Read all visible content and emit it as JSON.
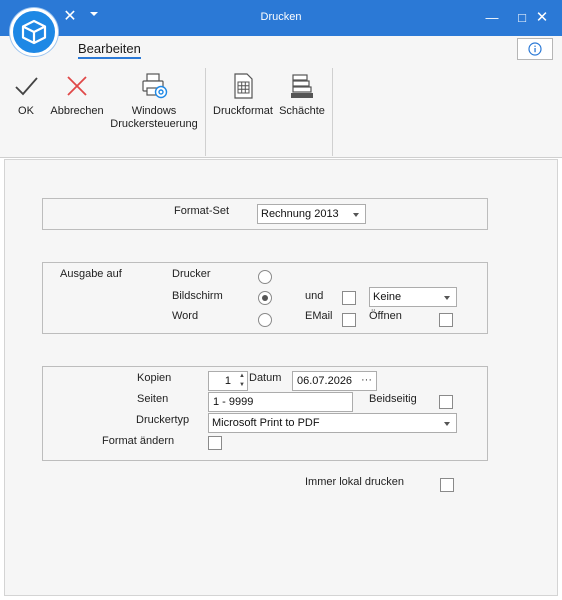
{
  "window": {
    "title": "Drucken",
    "minimize_icon": "minimize-icon",
    "maximize_icon": "maximize-icon",
    "close_icon": "close-icon"
  },
  "ribbon": {
    "tab": "Bearbeiten",
    "buttons": {
      "ok": "OK",
      "cancel": "Abbrechen",
      "printer_ctrl_line1": "Windows",
      "printer_ctrl_line2": "Druckersteuerung",
      "print_format": "Druckformat",
      "trays": "Schächte"
    }
  },
  "format_set": {
    "label": "Format-Set",
    "value": "Rechnung 2013"
  },
  "output": {
    "label": "Ausgabe auf",
    "options": [
      "Drucker",
      "Bildschirm",
      "Word"
    ],
    "selected_index": 1,
    "und_label": "und",
    "email_label": "EMail",
    "open_label": "Öffnen",
    "dropdown_value": "Keine"
  },
  "print_settings": {
    "copies_label": "Kopien",
    "copies_value": "1",
    "date_label": "Datum",
    "date_value": "06.07.2026",
    "pages_label": "Seiten",
    "pages_value": "1 - 9999",
    "duplex_label": "Beidseitig",
    "printer_type_label": "Druckertyp",
    "printer_type_value": "Microsoft Print to PDF",
    "change_format_label": "Format ändern"
  },
  "always_local_label": "Immer lokal drucken",
  "colors": {
    "titlebar": "#2b79d6",
    "cancel_red": "#e04848",
    "accent_blue": "#1e88e5"
  }
}
